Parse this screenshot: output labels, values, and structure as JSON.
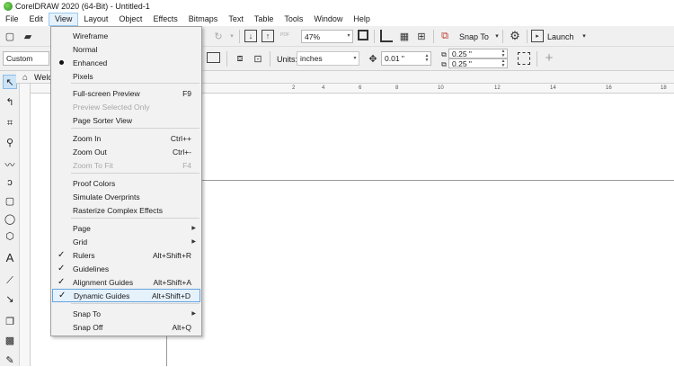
{
  "window": {
    "title": "CorelDRAW 2020 (64-Bit) - Untitled-1"
  },
  "menubar": [
    "File",
    "Edit",
    "View",
    "Layout",
    "Object",
    "Effects",
    "Bitmaps",
    "Text",
    "Table",
    "Tools",
    "Window",
    "Help"
  ],
  "toolbar": {
    "zoom": "47%",
    "snap_to": "Snap To",
    "launch": "Launch",
    "preset": "Custom",
    "units_label": "Units:",
    "units_value": "inches",
    "nudge": "0.01 \"",
    "dup_x": "0.25 \"",
    "dup_y": "0.25 \"",
    "pdf": "PDF"
  },
  "tabs": {
    "welcome": "Welc"
  },
  "ruler": {
    "h_ticks": [
      "2",
      "4",
      "6",
      "8",
      "10",
      "12",
      "14",
      "16",
      "18"
    ]
  },
  "view_menu": {
    "items": [
      {
        "label": "Wireframe",
        "shortcut": "",
        "state": "",
        "arrow": false,
        "disabled": false
      },
      {
        "label": "Normal",
        "shortcut": "",
        "state": "",
        "arrow": false,
        "disabled": false
      },
      {
        "label": "Enhanced",
        "shortcut": "",
        "state": "dot",
        "arrow": false,
        "disabled": false
      },
      {
        "label": "Pixels",
        "shortcut": "",
        "state": "",
        "arrow": false,
        "disabled": false
      },
      {
        "label": "Full-screen Preview",
        "shortcut": "F9",
        "state": "",
        "arrow": false,
        "disabled": false
      },
      {
        "label": "Preview Selected Only",
        "shortcut": "",
        "state": "",
        "arrow": false,
        "disabled": true
      },
      {
        "label": "Page Sorter View",
        "shortcut": "",
        "state": "",
        "arrow": false,
        "disabled": false
      },
      {
        "label": "Zoom In",
        "shortcut": "Ctrl++",
        "state": "",
        "arrow": false,
        "disabled": false
      },
      {
        "label": "Zoom Out",
        "shortcut": "Ctrl+-",
        "state": "",
        "arrow": false,
        "disabled": false
      },
      {
        "label": "Zoom To Fit",
        "shortcut": "F4",
        "state": "",
        "arrow": false,
        "disabled": true
      },
      {
        "label": "Proof Colors",
        "shortcut": "",
        "state": "",
        "arrow": false,
        "disabled": false
      },
      {
        "label": "Simulate Overprints",
        "shortcut": "",
        "state": "",
        "arrow": false,
        "disabled": false
      },
      {
        "label": "Rasterize Complex Effects",
        "shortcut": "",
        "state": "",
        "arrow": false,
        "disabled": false
      },
      {
        "label": "Page",
        "shortcut": "",
        "state": "",
        "arrow": true,
        "disabled": false
      },
      {
        "label": "Grid",
        "shortcut": "",
        "state": "",
        "arrow": true,
        "disabled": false
      },
      {
        "label": "Rulers",
        "shortcut": "Alt+Shift+R",
        "state": "check",
        "arrow": false,
        "disabled": false
      },
      {
        "label": "Guidelines",
        "shortcut": "",
        "state": "check",
        "arrow": false,
        "disabled": false
      },
      {
        "label": "Alignment Guides",
        "shortcut": "Alt+Shift+A",
        "state": "check",
        "arrow": false,
        "disabled": false
      },
      {
        "label": "Dynamic Guides",
        "shortcut": "Alt+Shift+D",
        "state": "check",
        "arrow": false,
        "disabled": false
      },
      {
        "label": "Snap To",
        "shortcut": "",
        "state": "",
        "arrow": true,
        "disabled": false
      },
      {
        "label": "Snap Off",
        "shortcut": "Alt+Q",
        "state": "",
        "arrow": false,
        "disabled": false
      }
    ]
  }
}
